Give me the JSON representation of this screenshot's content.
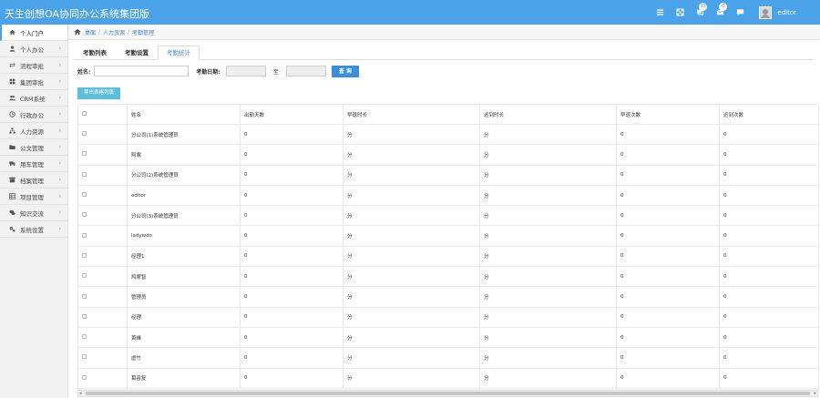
{
  "app": {
    "title": "天生创想OA协同办公系统集团版",
    "username": "editor",
    "badges": {
      "chat": "18",
      "mail": "0"
    },
    "accent": "#4aa3e8"
  },
  "topbar_icons": [
    "menu-icon",
    "fullscreen-icon",
    "chat-icon",
    "mail-icon",
    "message-icon"
  ],
  "sidebar": {
    "items": [
      {
        "label": "个人门户",
        "icon": "home-icon"
      },
      {
        "label": "个人办公",
        "icon": "user-icon"
      },
      {
        "label": "流程审批",
        "icon": "exchange-icon"
      },
      {
        "label": "集团审批",
        "icon": "grid-icon"
      },
      {
        "label": "CRM系统",
        "icon": "users-icon"
      },
      {
        "label": "行政办公",
        "icon": "clock-icon"
      },
      {
        "label": "人力资源",
        "icon": "sitemap-icon"
      },
      {
        "label": "公文管理",
        "icon": "folder-icon"
      },
      {
        "label": "用车管理",
        "icon": "truck-icon"
      },
      {
        "label": "档案管理",
        "icon": "archive-icon"
      },
      {
        "label": "项目管理",
        "icon": "table-icon"
      },
      {
        "label": "知识交流",
        "icon": "comments-icon"
      },
      {
        "label": "系统设置",
        "icon": "cogs-icon"
      }
    ]
  },
  "breadcrumb": [
    "桌面",
    "人力资源",
    "考勤管理"
  ],
  "tabs": [
    "考勤列表",
    "考勤设置",
    "考勤统计"
  ],
  "filter": {
    "name_label": "姓名:",
    "date_label": "考勤日期:",
    "to_label": "至",
    "search_button": "查 询"
  },
  "export_button": "导出表格列表",
  "table": {
    "columns": [
      "姓名",
      "出勤天数",
      "早退时长",
      "迟到时长",
      "早退次数",
      "迟到次数"
    ],
    "rows": [
      [
        "分公司(1)系统管理员",
        "0",
        "分",
        "分",
        "0",
        "0"
      ],
      [
        "阿紫",
        "0",
        "分",
        "分",
        "0",
        "0"
      ],
      [
        "分公司(2)系统管理员",
        "0",
        "分",
        "分",
        "0",
        "0"
      ],
      [
        "editor",
        "0",
        "分",
        "分",
        "0",
        "0"
      ],
      [
        "分公司(3)系统管理员",
        "0",
        "分",
        "分",
        "0",
        "0"
      ],
      [
        "ladywdo",
        "0",
        "分",
        "分",
        "0",
        "0"
      ],
      [
        "经理1",
        "0",
        "分",
        "分",
        "0",
        "0"
      ],
      [
        "鸠摩智",
        "0",
        "分",
        "分",
        "0",
        "0"
      ],
      [
        "管理员",
        "0",
        "分",
        "分",
        "0",
        "0"
      ],
      [
        "经理",
        "0",
        "分",
        "分",
        "0",
        "0"
      ],
      [
        "萧峰",
        "0",
        "分",
        "分",
        "0",
        "0"
      ],
      [
        "虚竹",
        "0",
        "分",
        "分",
        "0",
        "0"
      ],
      [
        "慕容复",
        "0",
        "分",
        "分",
        "0",
        "0"
      ]
    ]
  }
}
